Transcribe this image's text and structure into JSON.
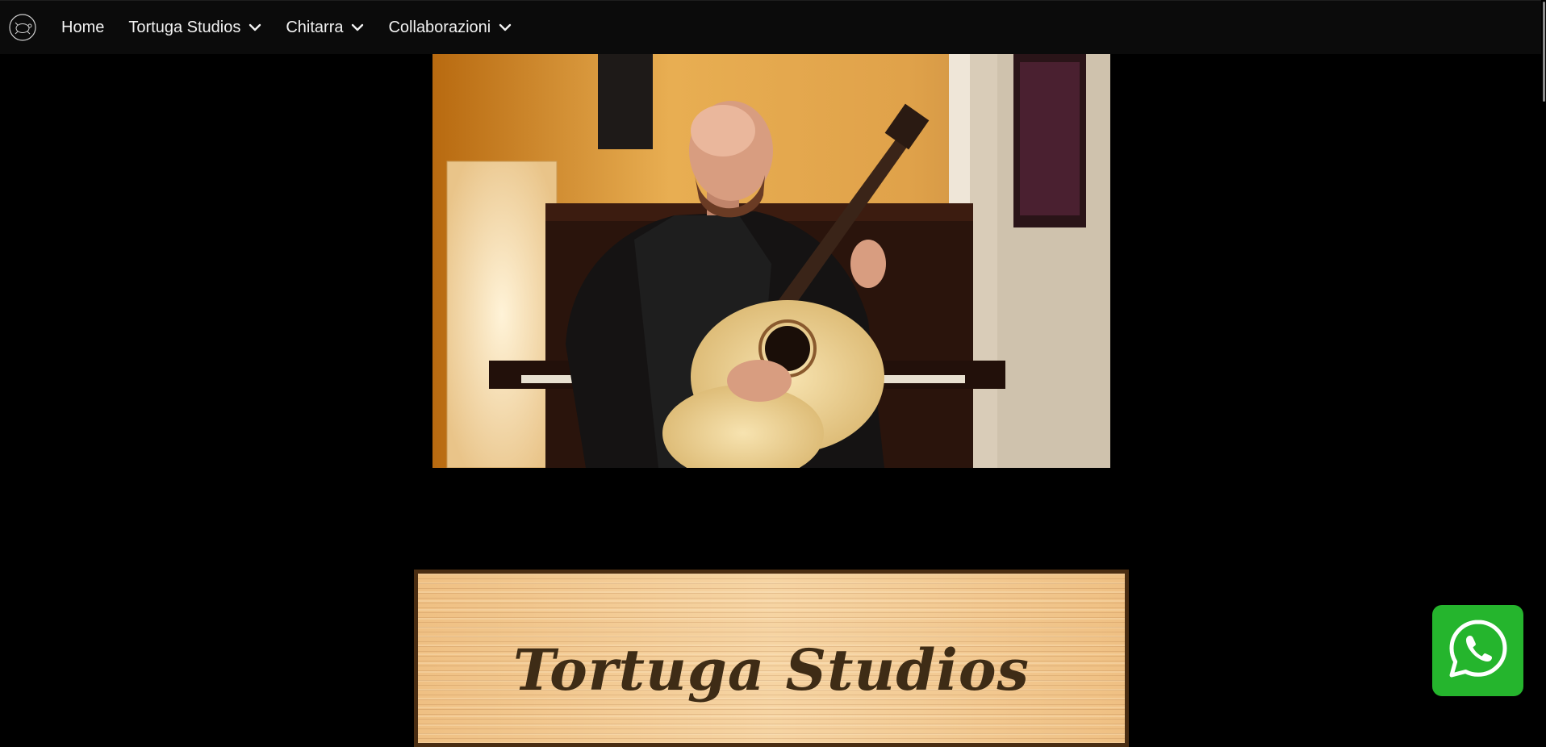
{
  "nav": {
    "logo_icon": "turtle-logo-icon",
    "items": [
      {
        "label": "Home",
        "has_dropdown": false
      },
      {
        "label": "Tortuga Studios",
        "has_dropdown": true
      },
      {
        "label": "Chitarra",
        "has_dropdown": true
      },
      {
        "label": "Collaborazioni",
        "has_dropdown": true
      }
    ]
  },
  "hero": {
    "image": "guitarist-photo",
    "description_icon": "classical-guitar-player-photo"
  },
  "banner": {
    "title": "Tortuga Studios"
  },
  "whatsapp": {
    "icon": "whatsapp-icon",
    "color": "#25b52d"
  },
  "colors": {
    "background": "#000000",
    "navbar": "#0b0b0b",
    "nav_text": "#f2f2f2"
  }
}
